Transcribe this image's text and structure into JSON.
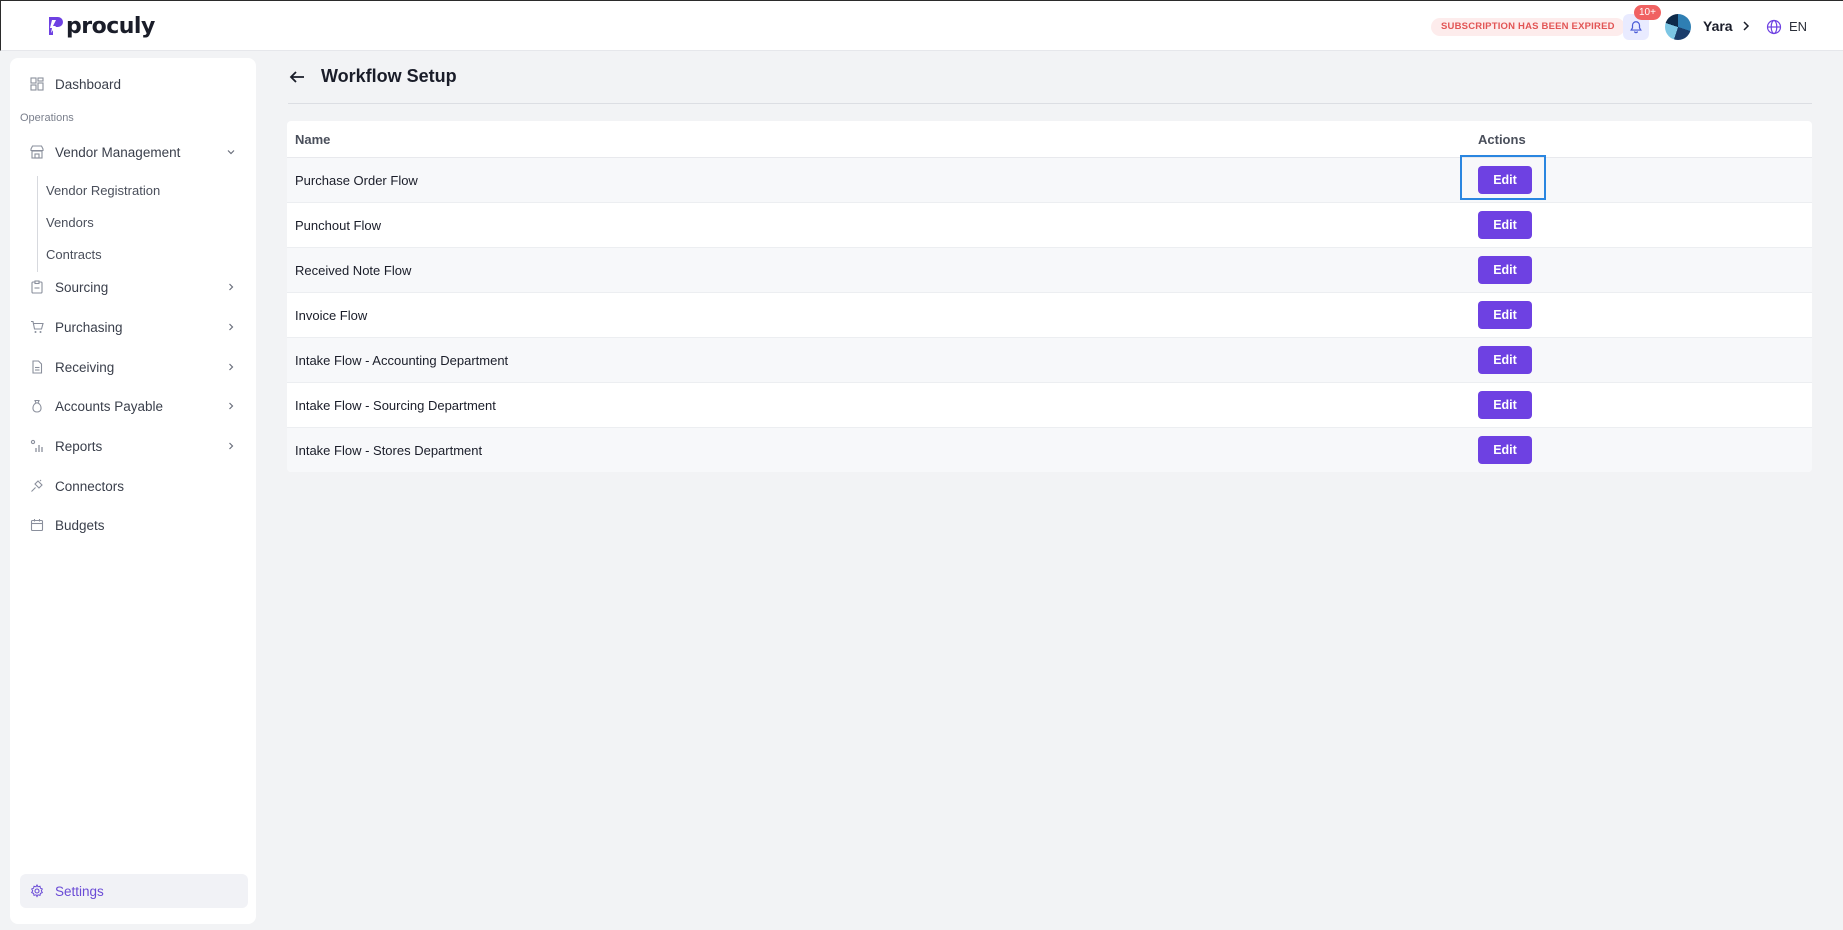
{
  "header": {
    "logo_text": "proculy",
    "subscription_notice": "SUBSCRIPTION HAS BEEN EXPIRED",
    "notifications_count": "10+",
    "user_name": "Yara",
    "language": "EN",
    "icons": [
      "bell-icon",
      "globe-icon",
      "chevron-right-icon"
    ]
  },
  "sidebar": {
    "dashboard": "Dashboard",
    "section": "Operations",
    "vendor_management": {
      "label": "Vendor Management",
      "children": [
        "Vendor Registration",
        "Vendors",
        "Contracts"
      ]
    },
    "items": [
      "Sourcing",
      "Purchasing",
      "Receiving",
      "Accounts Payable",
      "Reports",
      "Connectors",
      "Budgets"
    ],
    "settings": "Settings"
  },
  "page": {
    "title": "Workflow Setup"
  },
  "table": {
    "columns": [
      "Name",
      "Actions"
    ],
    "rows": [
      {
        "name": "Purchase Order Flow",
        "action": "Edit"
      },
      {
        "name": "Punchout Flow",
        "action": "Edit"
      },
      {
        "name": "Received Note Flow",
        "action": "Edit"
      },
      {
        "name": "Invoice Flow",
        "action": "Edit"
      },
      {
        "name": "Intake Flow - Accounting Department",
        "action": "Edit"
      },
      {
        "name": "Intake Flow - Sourcing Department",
        "action": "Edit"
      },
      {
        "name": "Intake Flow - Stores Department",
        "action": "Edit"
      }
    ]
  },
  "colors": {
    "accent": "#6e41e2",
    "alert": "#e25555",
    "focus": "#2a86e0"
  }
}
